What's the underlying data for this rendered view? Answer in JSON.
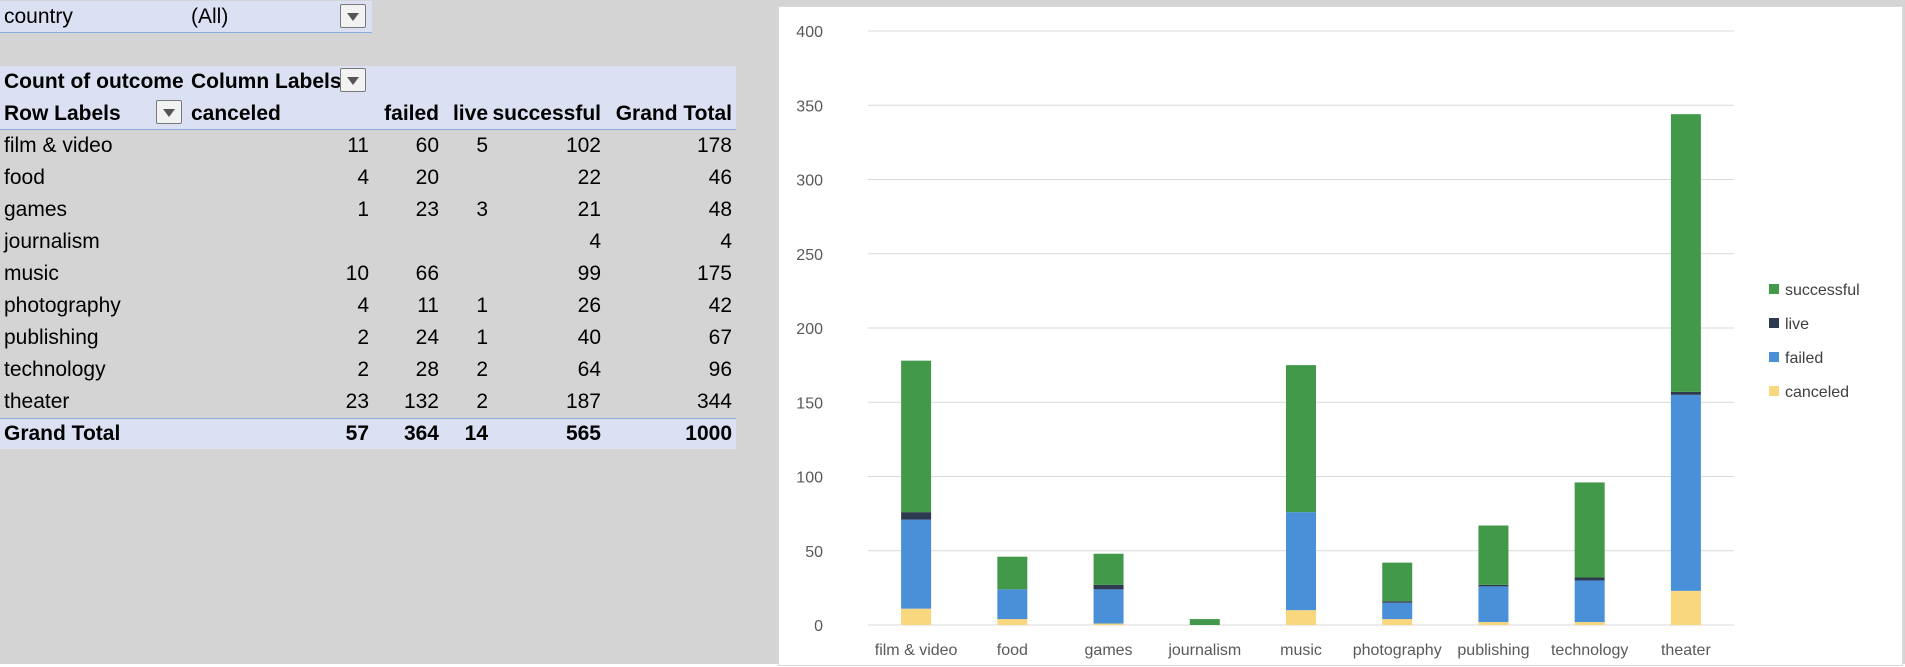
{
  "filter": {
    "field": "country",
    "value": "(All)"
  },
  "pivot": {
    "count_label": "Count of outcome",
    "column_labels": "Column Labels",
    "row_labels": "Row Labels",
    "headers": [
      "canceled",
      "failed",
      "live",
      "successful",
      "Grand Total"
    ],
    "rows": [
      {
        "label": "film & video",
        "canceled": "11",
        "failed": "60",
        "live": "5",
        "successful": "102",
        "total": "178"
      },
      {
        "label": "food",
        "canceled": "4",
        "failed": "20",
        "live": "",
        "successful": "22",
        "total": "46"
      },
      {
        "label": "games",
        "canceled": "1",
        "failed": "23",
        "live": "3",
        "successful": "21",
        "total": "48"
      },
      {
        "label": "journalism",
        "canceled": "",
        "failed": "",
        "live": "",
        "successful": "4",
        "total": "4"
      },
      {
        "label": "music",
        "canceled": "10",
        "failed": "66",
        "live": "",
        "successful": "99",
        "total": "175"
      },
      {
        "label": "photography",
        "canceled": "4",
        "failed": "11",
        "live": "1",
        "successful": "26",
        "total": "42"
      },
      {
        "label": "publishing",
        "canceled": "2",
        "failed": "24",
        "live": "1",
        "successful": "40",
        "total": "67"
      },
      {
        "label": "technology",
        "canceled": "2",
        "failed": "28",
        "live": "2",
        "successful": "64",
        "total": "96"
      },
      {
        "label": "theater",
        "canceled": "23",
        "failed": "132",
        "live": "2",
        "successful": "187",
        "total": "344"
      }
    ],
    "grand_total": {
      "label": "Grand Total",
      "canceled": "57",
      "failed": "364",
      "live": "14",
      "successful": "565",
      "total": "1000"
    }
  },
  "chart_data": {
    "type": "bar",
    "stacked": true,
    "categories": [
      "film & video",
      "food",
      "games",
      "journalism",
      "music",
      "photography",
      "publishing",
      "technology",
      "theater"
    ],
    "series": [
      {
        "name": "canceled",
        "color": "#f9d77e",
        "values": [
          11,
          4,
          1,
          0,
          10,
          4,
          2,
          2,
          23
        ]
      },
      {
        "name": "failed",
        "color": "#4a90d9",
        "values": [
          60,
          20,
          23,
          0,
          66,
          11,
          24,
          28,
          132
        ]
      },
      {
        "name": "live",
        "color": "#2e3a4f",
        "values": [
          5,
          0,
          3,
          0,
          0,
          1,
          1,
          2,
          2
        ]
      },
      {
        "name": "successful",
        "color": "#43994a",
        "values": [
          102,
          22,
          21,
          4,
          99,
          26,
          40,
          64,
          187
        ]
      }
    ],
    "ylim": [
      0,
      400
    ],
    "yticks": [
      "0",
      "50",
      "100",
      "150",
      "200",
      "250",
      "300",
      "350",
      "400"
    ],
    "legend_order": [
      "successful",
      "live",
      "failed",
      "canceled"
    ],
    "legend_position": "right",
    "grid": true
  },
  "colors": {
    "pivot_band": "#dbe1f2",
    "pivot_line": "#8ea9db"
  }
}
